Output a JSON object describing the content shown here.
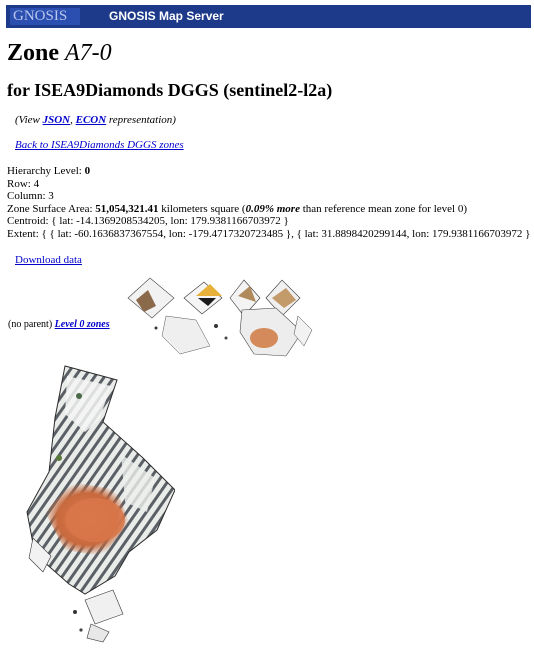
{
  "header": {
    "logo_text": "GNOSIS",
    "title": "GNOSIS Map Server",
    "bar_color": "#1d3a8a"
  },
  "page": {
    "zone_prefix": "Zone ",
    "zone_id": "A7-0",
    "subtitle": "for ISEA9Diamonds DGGS (sentinel2-l2a)"
  },
  "view": {
    "open": "(View ",
    "json_label": "JSON",
    "sep": ", ",
    "econ_label": "ECON",
    "close": " representation)"
  },
  "back_link": "Back to ISEA9Diamonds DGGS zones",
  "info": {
    "hierarchy_label": "Hierarchy Level: ",
    "hierarchy_value": "0",
    "row": "Row: 4",
    "column": "Column: 3",
    "area_label": "Zone Surface Area: ",
    "area_value": "51,054,321.41",
    "area_unit": " kilometers square (",
    "area_pct": "0.09% more",
    "area_tail": " than reference mean zone for level 0)",
    "centroid": "Centroid: { lat: -14.1369208534205, lon: 179.9381166703972 }",
    "extent": "Extent: { { lat: -60.1636837367554, lon: -179.4717320723485 }, { lat: 31.8898420299144, lon: 179.9381166703972 } }"
  },
  "download_label": "Download data",
  "parent": {
    "text": "(no parent) ",
    "link": "Level 0 zones"
  }
}
